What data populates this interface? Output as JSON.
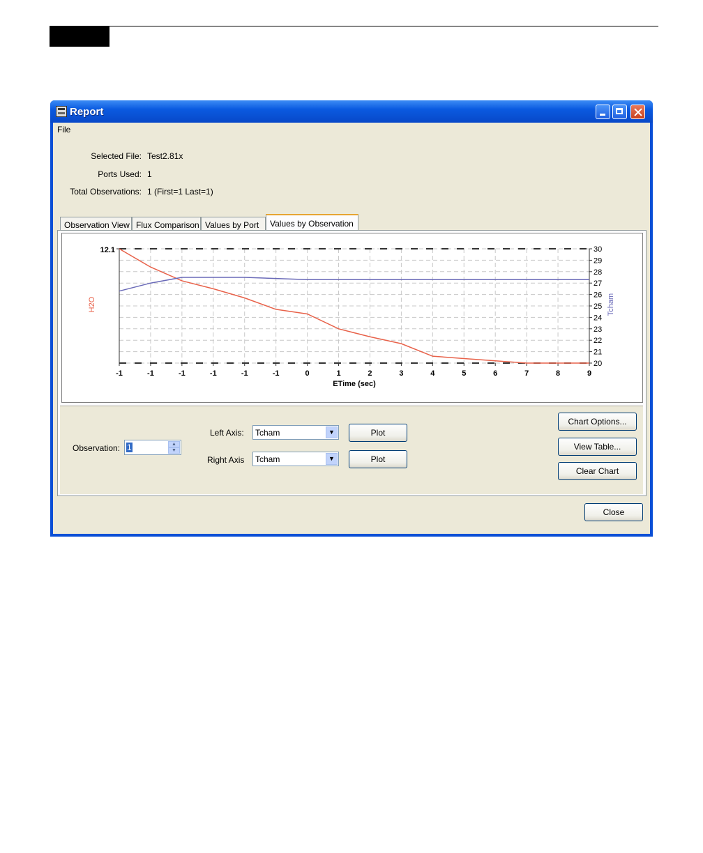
{
  "window": {
    "title": "Report"
  },
  "menu": {
    "file": "File"
  },
  "info": {
    "selected_file_label": "Selected File:",
    "selected_file_value": "Test2.81x",
    "ports_used_label": "Ports Used:",
    "ports_used_value": "1",
    "total_obs_label": "Total Observations:",
    "total_obs_value": "1 (First=1 Last=1)"
  },
  "tabs": [
    {
      "label": "Observation View"
    },
    {
      "label": "Flux Comparison"
    },
    {
      "label": "Values by Port"
    },
    {
      "label": "Values by Observation",
      "active": true
    }
  ],
  "controls": {
    "observation_label": "Observation:",
    "observation_value": "1",
    "left_axis_label": "Left Axis:",
    "left_axis_value": "Tcham",
    "right_axis_label": "Right Axis",
    "right_axis_value": "Tcham",
    "plot_label": "Plot",
    "chart_options_label": "Chart Options...",
    "view_table_label": "View Table...",
    "clear_chart_label": "Clear Chart",
    "close_label": "Close"
  },
  "colors": {
    "h2o": "#e8624a",
    "tcham": "#6a6ab8",
    "titlebar": "#0a5ae0"
  },
  "chart_data": {
    "type": "line",
    "xlabel": "ETime (sec)",
    "x_tick_labels": [
      "-1",
      "-1",
      "-1",
      "-1",
      "-1",
      "-1",
      "0",
      "1",
      "2",
      "3",
      "4",
      "5",
      "6",
      "7",
      "8",
      "9"
    ],
    "left_axis": {
      "label": "H2O",
      "max_label": "12.1"
    },
    "right_axis": {
      "label": "Tcham",
      "ylim": [
        20,
        30
      ],
      "ticks": [
        20,
        21,
        22,
        23,
        24,
        25,
        26,
        27,
        28,
        29,
        30
      ]
    },
    "grid": true,
    "series": [
      {
        "name": "H2O",
        "axis": "left",
        "y_fraction": [
          1.0,
          0.84,
          0.72,
          0.65,
          0.57,
          0.47,
          0.43,
          0.3,
          0.23,
          0.17,
          0.06,
          0.04,
          0.02,
          0.0,
          0.0,
          0.0
        ]
      },
      {
        "name": "Tcham",
        "axis": "right",
        "values": [
          26.3,
          27.0,
          27.5,
          27.5,
          27.5,
          27.4,
          27.3,
          27.3,
          27.3,
          27.3,
          27.3,
          27.3,
          27.3,
          27.3,
          27.3,
          27.3
        ]
      }
    ]
  }
}
